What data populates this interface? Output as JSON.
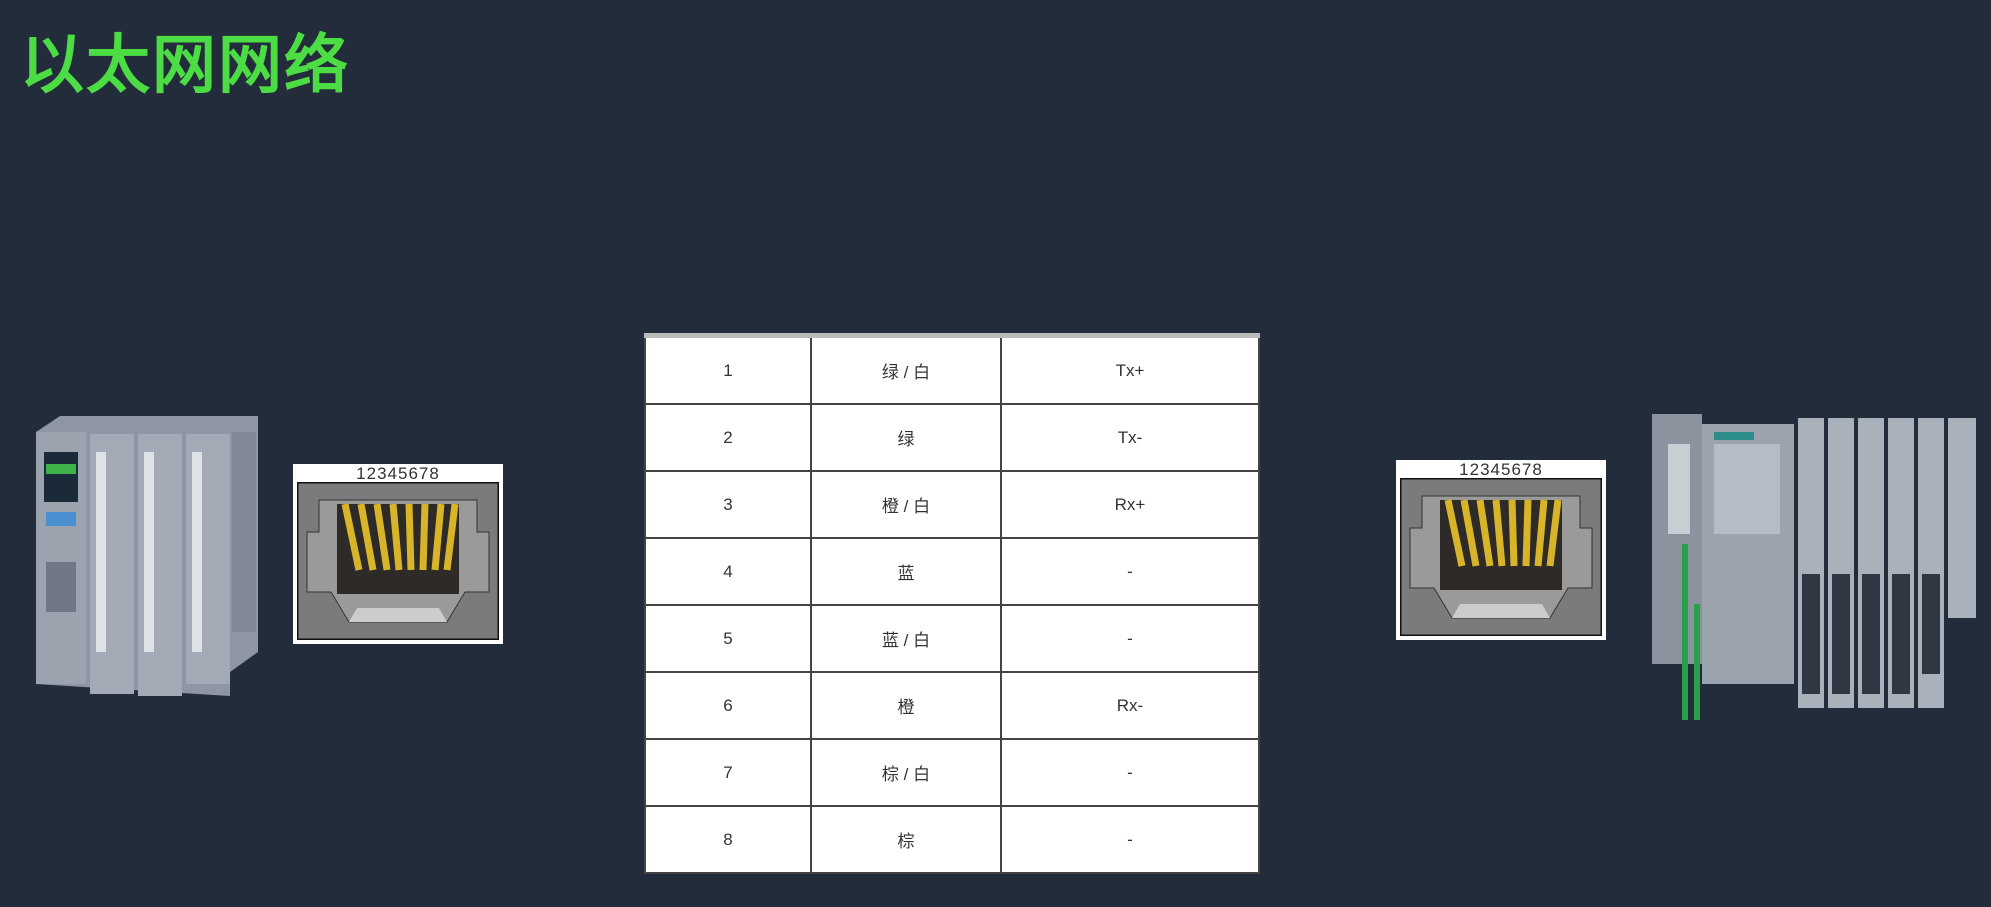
{
  "title": "以太网网络",
  "pinout_table": {
    "rows": [
      {
        "pin": "1",
        "color": "绿 / 白",
        "signal": "Tx+"
      },
      {
        "pin": "2",
        "color": "绿",
        "signal": "Tx-"
      },
      {
        "pin": "3",
        "color": "橙 / 白",
        "signal": "Rx+"
      },
      {
        "pin": "4",
        "color": "蓝",
        "signal": "-"
      },
      {
        "pin": "5",
        "color": "蓝 / 白",
        "signal": "-"
      },
      {
        "pin": "6",
        "color": "橙",
        "signal": "Rx-"
      },
      {
        "pin": "7",
        "color": "棕 / 白",
        "signal": "-"
      },
      {
        "pin": "8",
        "color": "棕",
        "signal": "-"
      }
    ]
  },
  "connector_left": {
    "pin_numbers": "12345678"
  },
  "connector_right": {
    "pin_numbers": "12345678"
  },
  "colors": {
    "background": "#232c3b",
    "title": "#4cdc44",
    "pin_contact": "#d8b42a"
  }
}
